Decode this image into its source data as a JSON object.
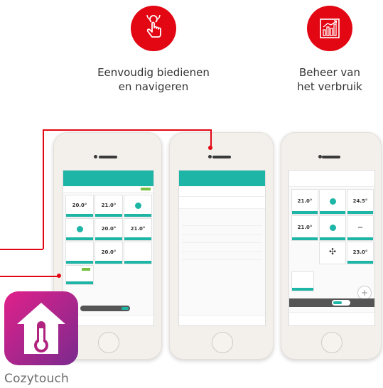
{
  "features": [
    {
      "icon": "tap-hand-icon",
      "line1": "Eenvoudig biedienen",
      "line2": "en navigeren"
    },
    {
      "icon": "usage-chart-icon",
      "line1": "Beheer van",
      "line2": "het verbruik"
    }
  ],
  "app": {
    "name": "Cozytouch",
    "icon_color_top": "#e0218a",
    "icon_color_bottom": "#7a2a8e"
  },
  "colors": {
    "accent_red": "#e30613",
    "app_teal": "#1db5a5"
  },
  "phone3": {
    "tiles": [
      {
        "value": "21.0°"
      },
      {
        "value": "24.5°"
      },
      {
        "value": "21.0°"
      },
      {
        "value": "—"
      },
      {
        "value": "23.0°"
      }
    ]
  }
}
